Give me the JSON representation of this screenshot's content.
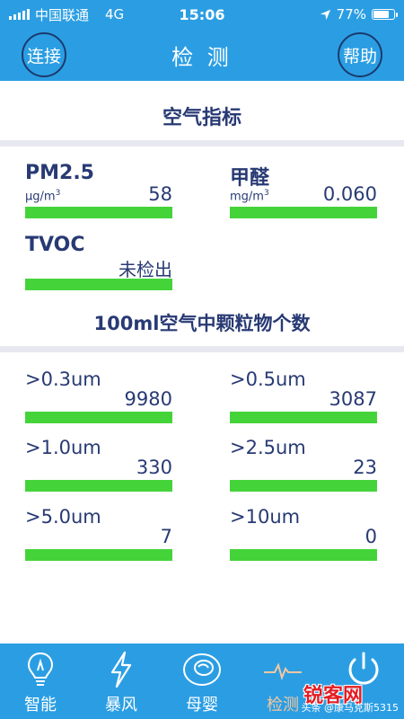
{
  "status_bar": {
    "carrier": "中国联通",
    "network": "4G",
    "time": "15:06",
    "battery": "77%"
  },
  "header": {
    "title": "检 测",
    "connect": "连接",
    "help": "帮助"
  },
  "air_index": {
    "title": "空气指标",
    "pm25": {
      "label": "PM2.5",
      "unit": "μg/m",
      "unit_sup": "3",
      "value": "58"
    },
    "formaldehyde": {
      "label": "甲醛",
      "unit": "mg/m",
      "unit_sup": "3",
      "value": "0.060"
    },
    "tvoc": {
      "label": "TVOC",
      "value": "未检出"
    }
  },
  "particles": {
    "title": "100ml空气中颗粒物个数",
    "items": [
      {
        "label": ">0.3um",
        "value": "9980"
      },
      {
        "label": ">0.5um",
        "value": "3087"
      },
      {
        "label": ">1.0um",
        "value": "330"
      },
      {
        "label": ">2.5um",
        "value": "23"
      },
      {
        "label": ">5.0um",
        "value": "7"
      },
      {
        "label": ">10um",
        "value": "0"
      }
    ]
  },
  "nav": [
    {
      "label": "智能",
      "icon": "lightbulb-icon"
    },
    {
      "label": "暴风",
      "icon": "lightning-icon"
    },
    {
      "label": "母婴",
      "icon": "baby-icon"
    },
    {
      "label": "检测",
      "icon": "pulse-icon"
    },
    {
      "label": "",
      "icon": "power-icon"
    }
  ],
  "watermark": {
    "big": "锐客网",
    "small": "头条 @康马克斯5315"
  },
  "colors": {
    "primary": "#2b9ee3",
    "text": "#283a74",
    "bar": "#44d43a"
  }
}
